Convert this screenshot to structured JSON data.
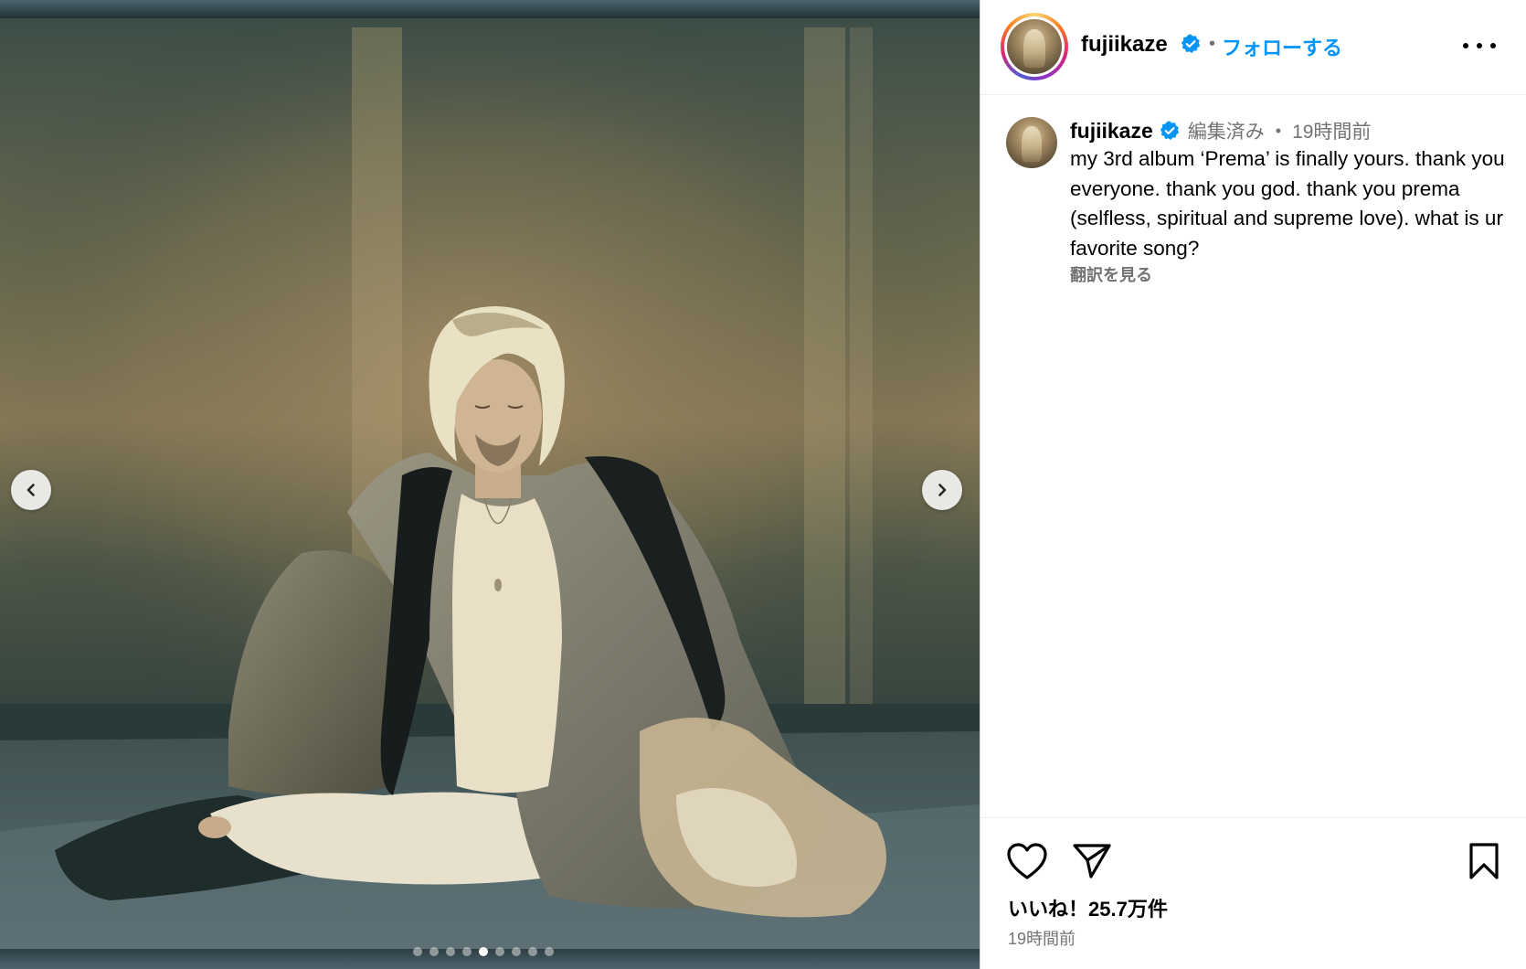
{
  "post": {
    "username": "fujiikaze",
    "follow_label": "フォローする",
    "bullet": "•",
    "caption": {
      "edited_label": "編集済み",
      "separator": "•",
      "time_ago": "19時間前",
      "text": "my 3rd album ‘Prema’ is finally yours. thank you everyone. thank you god. thank you prema (selfless, spiritual and supreme love). what is ur favorite song?",
      "translate_label": "翻訳を見る"
    },
    "likes_label": "いいね！25.7万件",
    "timestamp": "19時間前"
  },
  "carousel": {
    "dot_count": 9,
    "active_index": 4
  },
  "icons": {
    "verified": "verified-badge-icon",
    "more": "more-options-icon",
    "prev": "chevron-left-icon",
    "next": "chevron-right-icon",
    "like": "heart-icon",
    "share": "send-icon",
    "save": "bookmark-icon"
  },
  "colors": {
    "follow_blue": "#0095f6",
    "verified_blue": "#0095f6",
    "meta_gray": "#737373"
  }
}
